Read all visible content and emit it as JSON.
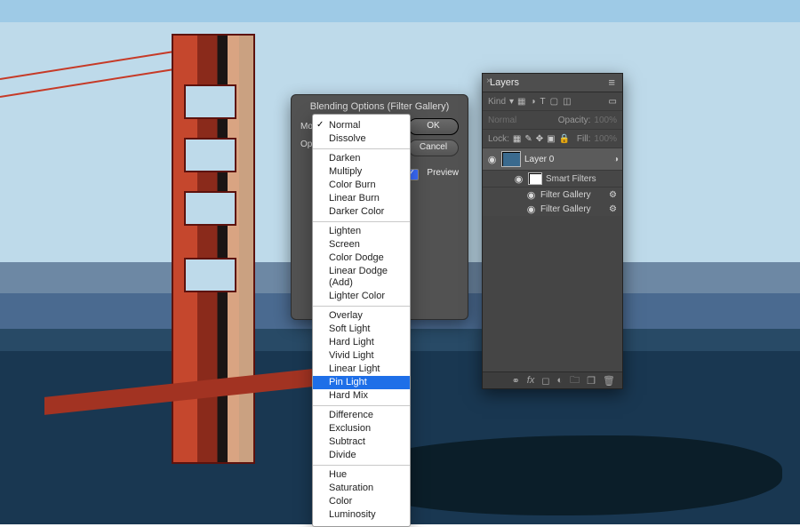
{
  "dialog": {
    "title": "Blending Options (Filter Gallery)",
    "mode_label": "Mode",
    "opacity_label": "Opac",
    "ok": "OK",
    "cancel": "Cancel",
    "preview": "Preview"
  },
  "blend_modes": {
    "selected": "Pin Light",
    "checked": "Normal",
    "groups": [
      [
        "Normal",
        "Dissolve"
      ],
      [
        "Darken",
        "Multiply",
        "Color Burn",
        "Linear Burn",
        "Darker Color"
      ],
      [
        "Lighten",
        "Screen",
        "Color Dodge",
        "Linear Dodge (Add)",
        "Lighter Color"
      ],
      [
        "Overlay",
        "Soft Light",
        "Hard Light",
        "Vivid Light",
        "Linear Light",
        "Pin Light",
        "Hard Mix"
      ],
      [
        "Difference",
        "Exclusion",
        "Subtract",
        "Divide"
      ],
      [
        "Hue",
        "Saturation",
        "Color",
        "Luminosity"
      ]
    ]
  },
  "layers_panel": {
    "title": "Layers",
    "kind_label": "Kind",
    "blend_mode": "Normal",
    "opacity_label": "Opacity:",
    "opacity_value": "100%",
    "lock_label": "Lock:",
    "fill_label": "Fill:",
    "fill_value": "100%",
    "layer0": "Layer 0",
    "smart_filters": "Smart Filters",
    "filter_entries": [
      "Filter Gallery",
      "Filter Gallery"
    ]
  }
}
